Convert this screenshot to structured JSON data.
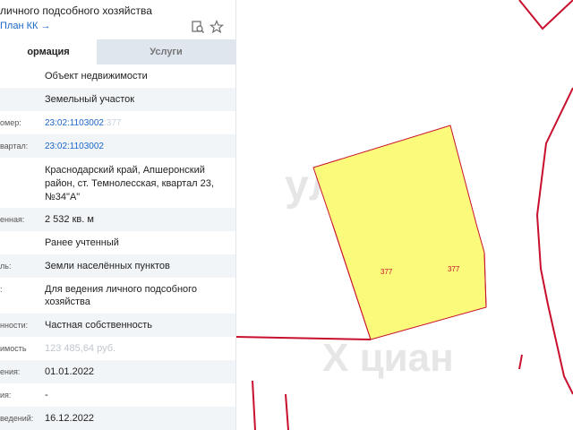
{
  "panel": {
    "title": "личного подсобного хозяйства",
    "plan_link": "План КК →",
    "tabs": [
      {
        "label": "ормация"
      },
      {
        "label": "Услуги"
      }
    ],
    "rows": [
      {
        "label": "",
        "value": "Объект недвижимости"
      },
      {
        "label": "",
        "value": "Земельный участок"
      },
      {
        "label": "омер:",
        "value": "23:02:1103002",
        "ghost": ":377"
      },
      {
        "label": "вартал:",
        "value": "23:02:1103002"
      },
      {
        "label": "",
        "value": "Краснодарский край, Апшеронский район, ст. Темнолесская, квартал 23, №34\"А\""
      },
      {
        "label": "енная:",
        "value": "2 532 кв. м"
      },
      {
        "label": "",
        "value": "Ранее учтенный"
      },
      {
        "label": "ль:",
        "value": "Земли населённых пунктов"
      },
      {
        "label": ":",
        "value": "Для ведения личного подсобного хозяйства"
      },
      {
        "label": "нности:",
        "value": "Частная собственность"
      },
      {
        "label": "имость",
        "value": "123 485,64 руб."
      },
      {
        "label": "ения:",
        "value": "01.01.2022"
      },
      {
        "label": "ия:",
        "value": "-"
      },
      {
        "label": "ведений:",
        "value": "16.12.2022"
      }
    ]
  },
  "map": {
    "parcel_labels": [
      "377",
      "377"
    ],
    "watermark_top": "улет",
    "watermark_bottom": "Х циан",
    "colors": {
      "parcel_fill": "#fbfa7a",
      "boundary": "#c8102e"
    }
  },
  "icons": [
    "document-search-icon",
    "star-icon"
  ]
}
